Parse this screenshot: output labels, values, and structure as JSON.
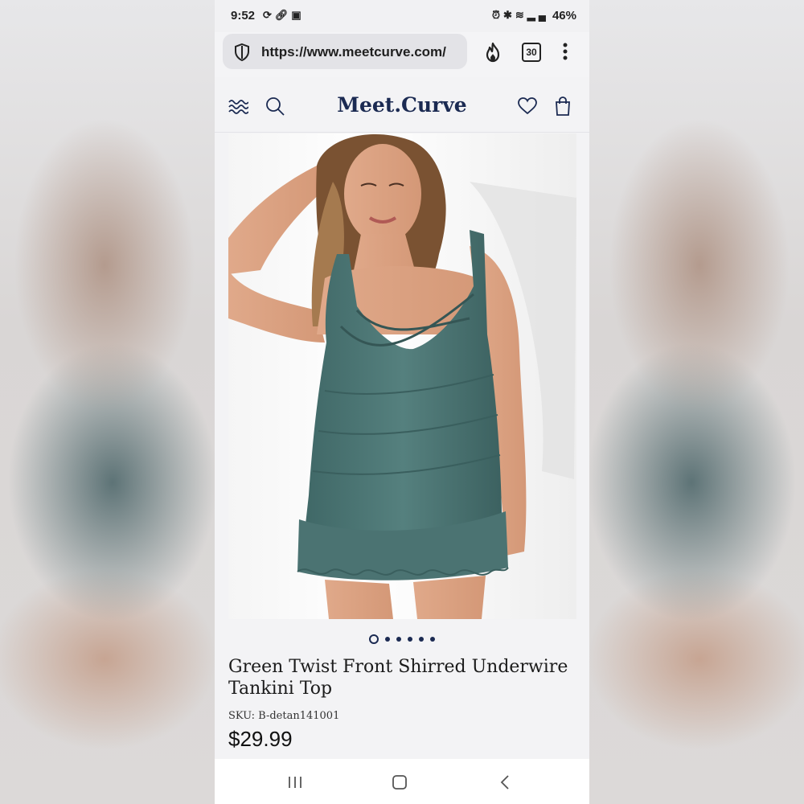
{
  "status_bar": {
    "time": "9:52",
    "left_icons": [
      "sync-icon",
      "link-icon",
      "gallery-icon"
    ],
    "right_icons": [
      "alarm-icon",
      "bluetooth-icon",
      "wifi-icon",
      "signal-icon"
    ],
    "battery": "46%"
  },
  "browser": {
    "url": "https://www.meetcurve.com/",
    "tab_count": "30"
  },
  "site": {
    "logo": "Meet.Curve"
  },
  "product": {
    "title": "Green Twist Front Shirred Underwire Tankini Top",
    "sku": "SKU: B-detan141001",
    "price": "$29.99",
    "image_count": 6,
    "active_image": 1
  },
  "colors": {
    "brand": "#1b2a52",
    "garment": "#4a7170"
  }
}
